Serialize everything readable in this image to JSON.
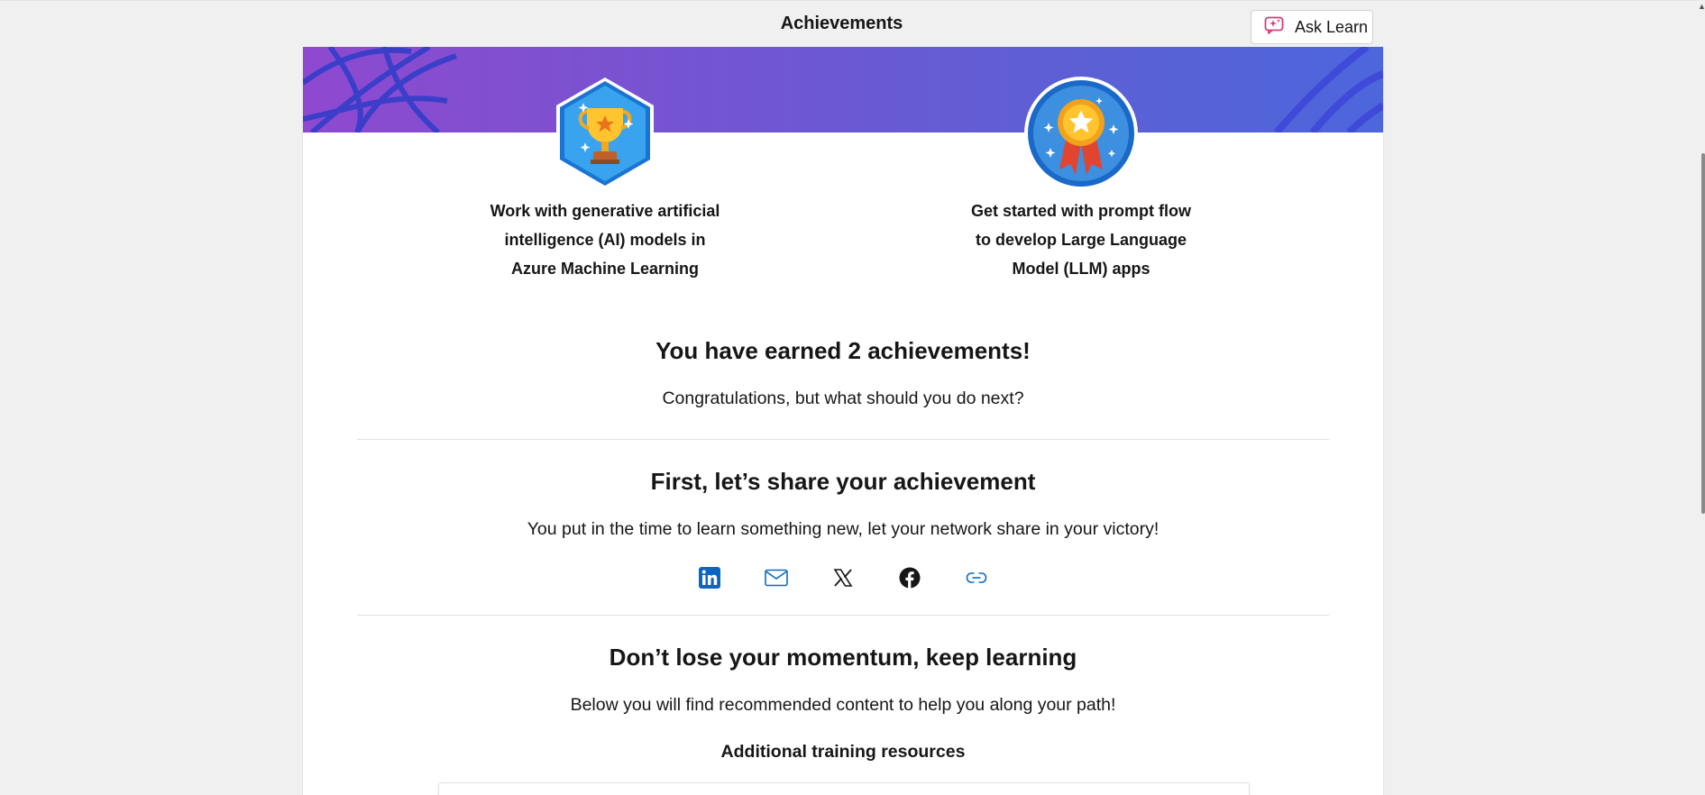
{
  "header": {
    "title": "Achievements",
    "ask_learn_label": "Ask Learn"
  },
  "badges": [
    {
      "icon": "trophy-icon",
      "title_lines": [
        "Work with generative artificial",
        "intelligence (AI) models in",
        "Azure Machine Learning"
      ]
    },
    {
      "icon": "medal-icon",
      "title_lines": [
        "Get started with prompt flow",
        "to develop Large Language",
        "Model (LLM) apps"
      ]
    }
  ],
  "summary": {
    "heading": "You have earned 2 achievements!",
    "subtext": "Congratulations, but what should you do next?"
  },
  "share": {
    "heading": "First, let’s share your achievement",
    "subtext": "You put in the time to learn something new, let your network share in your victory!",
    "icons": [
      "linkedin-icon",
      "email-icon",
      "x-icon",
      "facebook-icon",
      "link-icon"
    ]
  },
  "momentum": {
    "heading": "Don’t lose your momentum, keep learning",
    "subtext": "Below you will find recommended content to help you along your path!",
    "resources_heading": "Additional training resources"
  },
  "colors": {
    "banner_start": "#8e49d0",
    "banner_end": "#4d66dc",
    "linkedin": "#0a66c2",
    "link_blue": "#0f6cbd"
  }
}
